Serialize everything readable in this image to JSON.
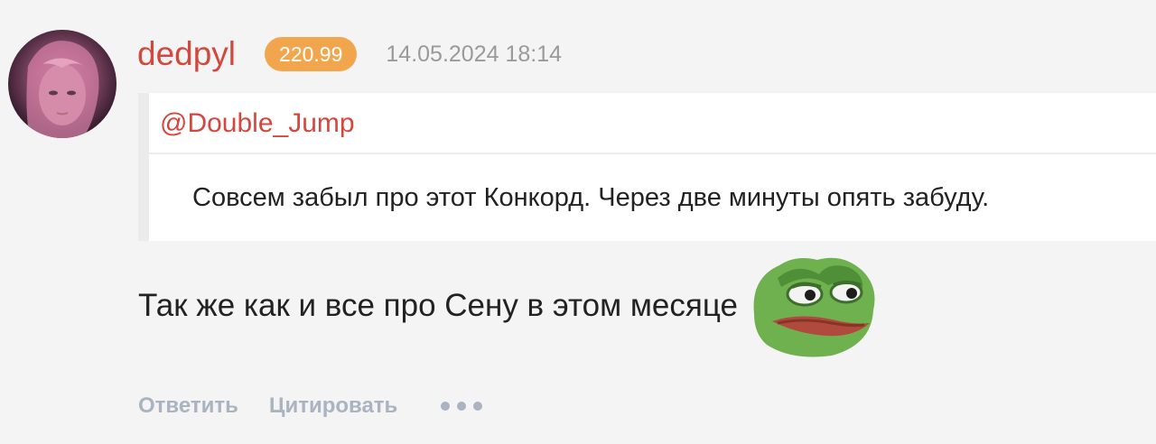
{
  "comment": {
    "author": "dedpyl",
    "rating": "220.99",
    "timestamp": "14.05.2024 18:14",
    "quote": {
      "author": "@Double_Jump",
      "text": "Совсем забыл про этот Конкорд. Через две минуты опять забуду."
    },
    "body": "Так же как и все про Сену в этом месяце",
    "actions": {
      "reply": "Ответить",
      "quote": "Цитировать"
    }
  },
  "icons": {
    "avatar": "user-avatar-image",
    "sticker": "pepe-frog-sticker",
    "more": "more-dots-icon"
  },
  "colors": {
    "username": "#d2483f",
    "rating_badge": "#f1a64d",
    "timestamp": "#9a9a9a",
    "action": "#a9b4c0"
  }
}
